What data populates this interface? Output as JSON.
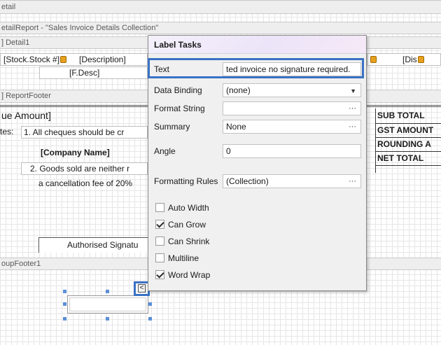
{
  "bands": {
    "top": "etail",
    "detail_report": "etailReport - \"Sales Invoice Details Collection\"",
    "detail1": "] Detail1",
    "report_footer": "] ReportFooter",
    "group_footer": "oupFooter1"
  },
  "detail_row": {
    "stock": "[Stock.Stock #]",
    "description": "[Description]",
    "f_desc": "[F.Desc]",
    "dis": "[Dis"
  },
  "footer": {
    "amount": "ue Amount]",
    "notes_label": "tes:",
    "note1": "1. All cheques should be cr",
    "company": "[Company Name]",
    "note2": "2. Goods sold are neither r",
    "note2b": "a cancellation fee of 20%",
    "authorised": "Authorised Signatu",
    "totals": [
      "SUB TOTAL",
      "GST AMOUNT",
      "ROUNDING A",
      "NET TOTAL"
    ]
  },
  "popup": {
    "title": "Label Tasks",
    "text_label": "Text",
    "text_value": "ted invoice no signature required.",
    "binding_label": "Data Binding",
    "binding_value": "(none)",
    "format_label": "Format String",
    "format_value": "",
    "summary_label": "Summary",
    "summary_value": "None",
    "angle_label": "Angle",
    "angle_value": "0",
    "rules_label": "Formatting Rules",
    "rules_value": "(Collection)",
    "ellipsis": "···",
    "dropdown": "▼",
    "checkboxes": [
      {
        "label": "Auto Width",
        "checked": false
      },
      {
        "label": "Can Grow",
        "checked": true
      },
      {
        "label": "Can Shrink",
        "checked": false
      },
      {
        "label": "Multiline",
        "checked": false
      },
      {
        "label": "Word Wrap",
        "checked": true
      }
    ]
  },
  "smart_tag": "<",
  "colors": {
    "highlight": "#3a72c4",
    "band": "#eeeeee",
    "popup": "#f0f0f0"
  }
}
